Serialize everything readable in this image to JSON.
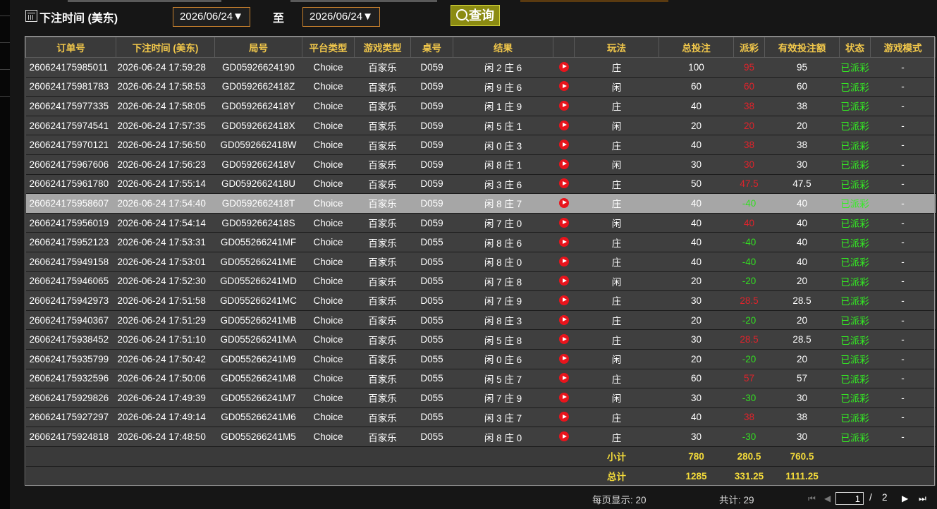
{
  "filter": {
    "label": "下注时间 (美东)",
    "date_from": "2026/06/24▼",
    "to_label": "至",
    "date_to": "2026/06/24▼",
    "query_label": "查询"
  },
  "table": {
    "headers": [
      "订单号",
      "下注时间 (美东)",
      "局号",
      "平台类型",
      "游戏类型",
      "桌号",
      "结果",
      "",
      "玩法",
      "总投注",
      "派彩",
      "有效投注额",
      "状态",
      "游戏模式"
    ],
    "rows": [
      {
        "id": "260624175985011",
        "time": "2026-06-24 17:59:28",
        "round": "GD05926624190",
        "platform": "Choice",
        "game": "百家乐",
        "table": "D059",
        "result": "闲 2 庄 6",
        "play": "庄",
        "bet": "100",
        "payout": "95",
        "payout_type": "red",
        "valid": "95",
        "status": "已派彩",
        "mode": "-"
      },
      {
        "id": "260624175981783",
        "time": "2026-06-24 17:58:53",
        "round": "GD0592662418Z",
        "platform": "Choice",
        "game": "百家乐",
        "table": "D059",
        "result": "闲 9 庄 6",
        "play": "闲",
        "bet": "60",
        "payout": "60",
        "payout_type": "red",
        "valid": "60",
        "status": "已派彩",
        "mode": "-"
      },
      {
        "id": "260624175977335",
        "time": "2026-06-24 17:58:05",
        "round": "GD0592662418Y",
        "platform": "Choice",
        "game": "百家乐",
        "table": "D059",
        "result": "闲 1 庄 9",
        "play": "庄",
        "bet": "40",
        "payout": "38",
        "payout_type": "red",
        "valid": "38",
        "status": "已派彩",
        "mode": "-"
      },
      {
        "id": "260624175974541",
        "time": "2026-06-24 17:57:35",
        "round": "GD0592662418X",
        "platform": "Choice",
        "game": "百家乐",
        "table": "D059",
        "result": "闲 5 庄 1",
        "play": "闲",
        "bet": "20",
        "payout": "20",
        "payout_type": "red",
        "valid": "20",
        "status": "已派彩",
        "mode": "-"
      },
      {
        "id": "260624175970121",
        "time": "2026-06-24 17:56:50",
        "round": "GD0592662418W",
        "platform": "Choice",
        "game": "百家乐",
        "table": "D059",
        "result": "闲 0 庄 3",
        "play": "庄",
        "bet": "40",
        "payout": "38",
        "payout_type": "red",
        "valid": "38",
        "status": "已派彩",
        "mode": "-"
      },
      {
        "id": "260624175967606",
        "time": "2026-06-24 17:56:23",
        "round": "GD0592662418V",
        "platform": "Choice",
        "game": "百家乐",
        "table": "D059",
        "result": "闲 8 庄 1",
        "play": "闲",
        "bet": "30",
        "payout": "30",
        "payout_type": "red",
        "valid": "30",
        "status": "已派彩",
        "mode": "-"
      },
      {
        "id": "260624175961780",
        "time": "2026-06-24 17:55:14",
        "round": "GD0592662418U",
        "platform": "Choice",
        "game": "百家乐",
        "table": "D059",
        "result": "闲 3 庄 6",
        "play": "庄",
        "bet": "50",
        "payout": "47.5",
        "payout_type": "red",
        "valid": "47.5",
        "status": "已派彩",
        "mode": "-"
      },
      {
        "id": "260624175958607",
        "time": "2026-06-24 17:54:40",
        "round": "GD0592662418T",
        "platform": "Choice",
        "game": "百家乐",
        "table": "D059",
        "result": "闲 8 庄 7",
        "play": "庄",
        "bet": "40",
        "payout": "-40",
        "payout_type": "grn",
        "valid": "40",
        "status": "已派彩",
        "mode": "-",
        "selected": true
      },
      {
        "id": "260624175956019",
        "time": "2026-06-24 17:54:14",
        "round": "GD0592662418S",
        "platform": "Choice",
        "game": "百家乐",
        "table": "D059",
        "result": "闲 7 庄 0",
        "play": "闲",
        "bet": "40",
        "payout": "40",
        "payout_type": "red",
        "valid": "40",
        "status": "已派彩",
        "mode": "-"
      },
      {
        "id": "260624175952123",
        "time": "2026-06-24 17:53:31",
        "round": "GD055266241MF",
        "platform": "Choice",
        "game": "百家乐",
        "table": "D055",
        "result": "闲 8 庄 6",
        "play": "庄",
        "bet": "40",
        "payout": "-40",
        "payout_type": "grn",
        "valid": "40",
        "status": "已派彩",
        "mode": "-"
      },
      {
        "id": "260624175949158",
        "time": "2026-06-24 17:53:01",
        "round": "GD055266241ME",
        "platform": "Choice",
        "game": "百家乐",
        "table": "D055",
        "result": "闲 8 庄 0",
        "play": "庄",
        "bet": "40",
        "payout": "-40",
        "payout_type": "grn",
        "valid": "40",
        "status": "已派彩",
        "mode": "-"
      },
      {
        "id": "260624175946065",
        "time": "2026-06-24 17:52:30",
        "round": "GD055266241MD",
        "platform": "Choice",
        "game": "百家乐",
        "table": "D055",
        "result": "闲 7 庄 8",
        "play": "闲",
        "bet": "20",
        "payout": "-20",
        "payout_type": "grn",
        "valid": "20",
        "status": "已派彩",
        "mode": "-"
      },
      {
        "id": "260624175942973",
        "time": "2026-06-24 17:51:58",
        "round": "GD055266241MC",
        "platform": "Choice",
        "game": "百家乐",
        "table": "D055",
        "result": "闲 7 庄 9",
        "play": "庄",
        "bet": "30",
        "payout": "28.5",
        "payout_type": "red",
        "valid": "28.5",
        "status": "已派彩",
        "mode": "-"
      },
      {
        "id": "260624175940367",
        "time": "2026-06-24 17:51:29",
        "round": "GD055266241MB",
        "platform": "Choice",
        "game": "百家乐",
        "table": "D055",
        "result": "闲 8 庄 3",
        "play": "庄",
        "bet": "20",
        "payout": "-20",
        "payout_type": "grn",
        "valid": "20",
        "status": "已派彩",
        "mode": "-"
      },
      {
        "id": "260624175938452",
        "time": "2026-06-24 17:51:10",
        "round": "GD055266241MA",
        "platform": "Choice",
        "game": "百家乐",
        "table": "D055",
        "result": "闲 5 庄 8",
        "play": "庄",
        "bet": "30",
        "payout": "28.5",
        "payout_type": "red",
        "valid": "28.5",
        "status": "已派彩",
        "mode": "-"
      },
      {
        "id": "260624175935799",
        "time": "2026-06-24 17:50:42",
        "round": "GD055266241M9",
        "platform": "Choice",
        "game": "百家乐",
        "table": "D055",
        "result": "闲 0 庄 6",
        "play": "闲",
        "bet": "20",
        "payout": "-20",
        "payout_type": "grn",
        "valid": "20",
        "status": "已派彩",
        "mode": "-"
      },
      {
        "id": "260624175932596",
        "time": "2026-06-24 17:50:06",
        "round": "GD055266241M8",
        "platform": "Choice",
        "game": "百家乐",
        "table": "D055",
        "result": "闲 5 庄 7",
        "play": "庄",
        "bet": "60",
        "payout": "57",
        "payout_type": "red",
        "valid": "57",
        "status": "已派彩",
        "mode": "-"
      },
      {
        "id": "260624175929826",
        "time": "2026-06-24 17:49:39",
        "round": "GD055266241M7",
        "platform": "Choice",
        "game": "百家乐",
        "table": "D055",
        "result": "闲 7 庄 9",
        "play": "闲",
        "bet": "30",
        "payout": "-30",
        "payout_type": "grn",
        "valid": "30",
        "status": "已派彩",
        "mode": "-"
      },
      {
        "id": "260624175927297",
        "time": "2026-06-24 17:49:14",
        "round": "GD055266241M6",
        "platform": "Choice",
        "game": "百家乐",
        "table": "D055",
        "result": "闲 3 庄 7",
        "play": "庄",
        "bet": "40",
        "payout": "38",
        "payout_type": "red",
        "valid": "38",
        "status": "已派彩",
        "mode": "-"
      },
      {
        "id": "260624175924818",
        "time": "2026-06-24 17:48:50",
        "round": "GD055266241M5",
        "platform": "Choice",
        "game": "百家乐",
        "table": "D055",
        "result": "闲 8 庄 0",
        "play": "庄",
        "bet": "30",
        "payout": "-30",
        "payout_type": "grn",
        "valid": "30",
        "status": "已派彩",
        "mode": "-"
      }
    ],
    "subtotal": {
      "label": "小计",
      "bet": "780",
      "payout": "280.5",
      "valid": "760.5"
    },
    "total": {
      "label": "总计",
      "bet": "1285",
      "payout": "331.25",
      "valid": "1111.25"
    }
  },
  "pagination": {
    "per_page_text": "每页显示: 20",
    "total_text": "共计: 29",
    "current_page": "1",
    "separator": "/",
    "total_pages": "2",
    "first_glyph": "⏮",
    "prev_glyph": "◀",
    "next_glyph": "▶",
    "last_glyph": "⏭"
  },
  "icons": {
    "row_action": "play-icon",
    "filter": "calendar-icon",
    "query": "search-icon"
  },
  "colors": {
    "header_text": "#f2c84b",
    "win": "#e0232b",
    "loss": "#33dd22",
    "status": "#33ee22",
    "accent_border": "#c8812d"
  }
}
